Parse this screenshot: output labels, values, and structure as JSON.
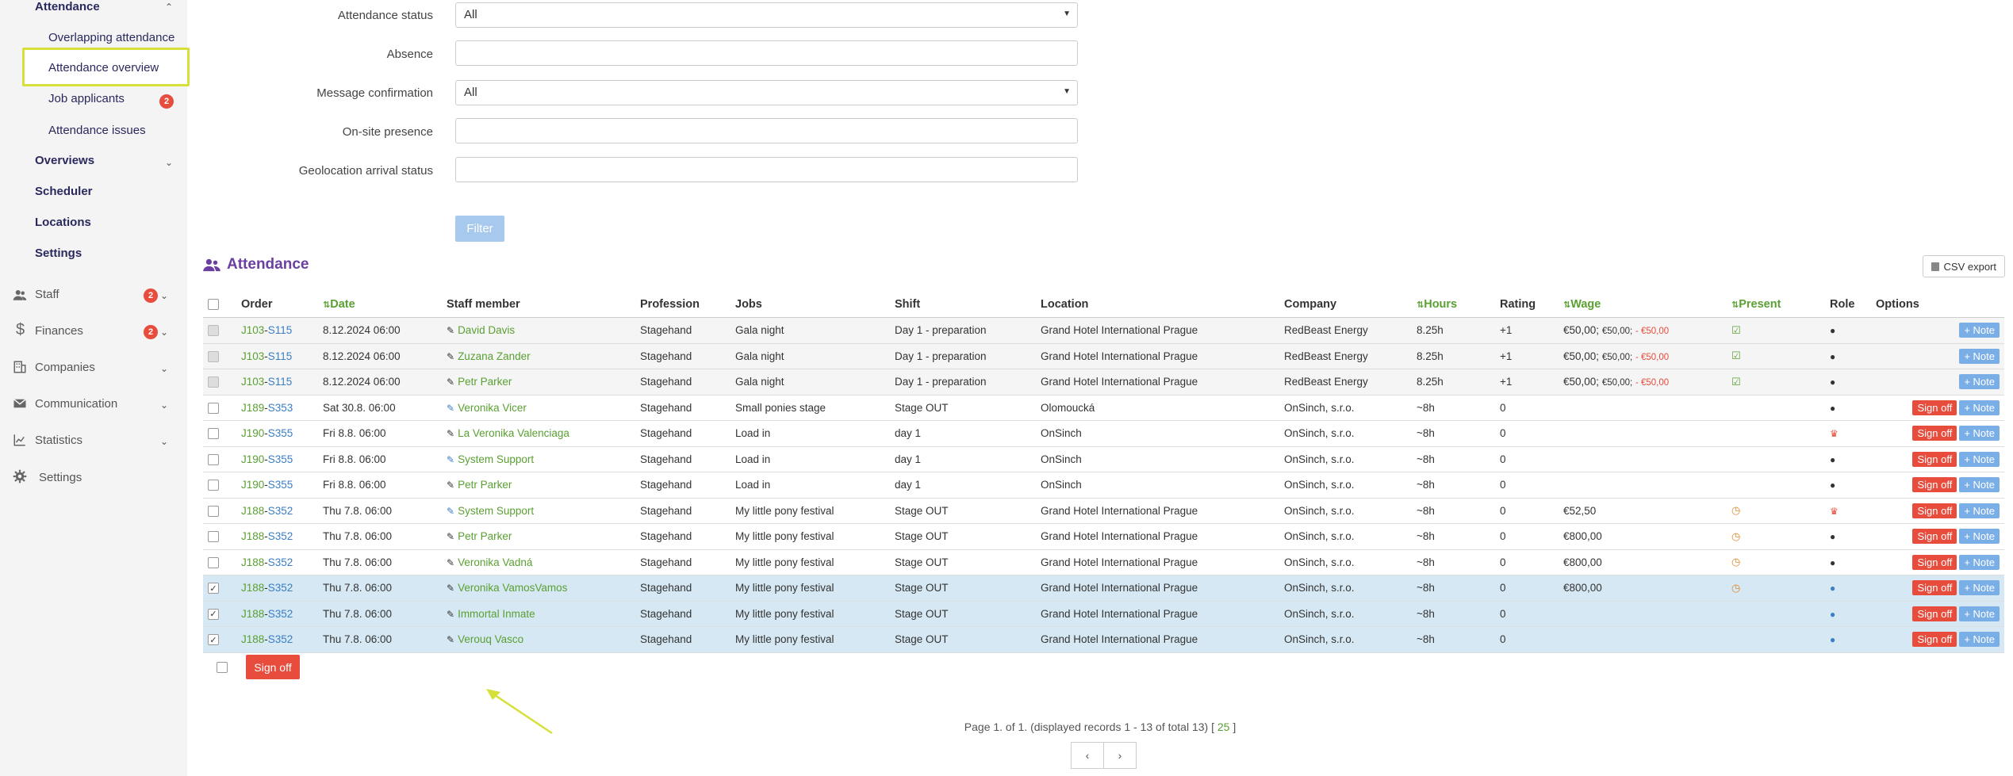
{
  "sidebar": {
    "attendance": "Attendance",
    "overlapping": "Overlapping attendance",
    "overview": "Attendance overview",
    "job_applicants": "Job applicants",
    "job_applicants_badge": "2",
    "issues": "Attendance issues",
    "overviews": "Overviews",
    "scheduler": "Scheduler",
    "locations": "Locations",
    "settings_sub": "Settings",
    "staff": "Staff",
    "staff_badge": "2",
    "finances": "Finances",
    "finances_badge": "2",
    "companies": "Companies",
    "communication": "Communication",
    "statistics": "Statistics",
    "settings": "Settings"
  },
  "filters": {
    "attendance_status_label": "Attendance status",
    "attendance_status_value": "All",
    "absence_label": "Absence",
    "message_confirmation_label": "Message confirmation",
    "message_confirmation_value": "All",
    "onsite_label": "On-site presence",
    "geo_label": "Geolocation arrival status",
    "filter_button": "Filter"
  },
  "section": {
    "title": "Attendance",
    "csv_export": "CSV export"
  },
  "table": {
    "headers": {
      "order": "Order",
      "date": "Date",
      "staff": "Staff member",
      "profession": "Profession",
      "jobs": "Jobs",
      "shift": "Shift",
      "location": "Location",
      "company": "Company",
      "hours": "Hours",
      "rating": "Rating",
      "wage": "Wage",
      "present": "Present",
      "role": "Role",
      "options": "Options"
    },
    "sign_off": "Sign off",
    "note": "Note",
    "rows": [
      {
        "o1": "J103",
        "o2": "S115",
        "date": "8.12.2024 06:00",
        "staff": "David Davis",
        "prof": "Stagehand",
        "jobs": "Gala night",
        "shift": "Day 1 - preparation",
        "loc": "Grand Hotel International Prague",
        "comp": "RedBeast Energy",
        "hours": "8.25h",
        "rating": "+1",
        "w1": "€50,00;",
        "w2": "€50,00;",
        "w3": "- €50,00"
      },
      {
        "o1": "J103",
        "o2": "S115",
        "date": "8.12.2024 06:00",
        "staff": "Zuzana Zander",
        "prof": "Stagehand",
        "jobs": "Gala night",
        "shift": "Day 1 - preparation",
        "loc": "Grand Hotel International Prague",
        "comp": "RedBeast Energy",
        "hours": "8.25h",
        "rating": "+1",
        "w1": "€50,00;",
        "w2": "€50,00;",
        "w3": "- €50,00"
      },
      {
        "o1": "J103",
        "o2": "S115",
        "date": "8.12.2024 06:00",
        "staff": "Petr Parker",
        "prof": "Stagehand",
        "jobs": "Gala night",
        "shift": "Day 1 - preparation",
        "loc": "Grand Hotel International Prague",
        "comp": "RedBeast Energy",
        "hours": "8.25h",
        "rating": "+1",
        "w1": "€50,00;",
        "w2": "€50,00;",
        "w3": "- €50,00"
      },
      {
        "o1": "J189",
        "o2": "S353",
        "date": "Sat 30.8. 06:00",
        "staff": "Veronika Vicer",
        "prof": "Stagehand",
        "jobs": "Small ponies stage",
        "shift": "Stage OUT",
        "loc": "Olomoucká",
        "comp": "OnSinch, s.r.o.",
        "hours": "~8h",
        "rating": "0",
        "w1": "",
        "w2": "",
        "w3": ""
      },
      {
        "o1": "J190",
        "o2": "S355",
        "date": "Fri 8.8. 06:00",
        "staff": "La Veronika Valenciaga",
        "prof": "Stagehand",
        "jobs": "Load in",
        "shift": "day 1",
        "loc": "OnSinch",
        "comp": "OnSinch, s.r.o.",
        "hours": "~8h",
        "rating": "0",
        "w1": "",
        "w2": "",
        "w3": ""
      },
      {
        "o1": "J190",
        "o2": "S355",
        "date": "Fri 8.8. 06:00",
        "staff": "System Support",
        "prof": "Stagehand",
        "jobs": "Load in",
        "shift": "day 1",
        "loc": "OnSinch",
        "comp": "OnSinch, s.r.o.",
        "hours": "~8h",
        "rating": "0",
        "w1": "",
        "w2": "",
        "w3": ""
      },
      {
        "o1": "J190",
        "o2": "S355",
        "date": "Fri 8.8. 06:00",
        "staff": "Petr Parker",
        "prof": "Stagehand",
        "jobs": "Load in",
        "shift": "day 1",
        "loc": "OnSinch",
        "comp": "OnSinch, s.r.o.",
        "hours": "~8h",
        "rating": "0",
        "w1": "",
        "w2": "",
        "w3": ""
      },
      {
        "o1": "J188",
        "o2": "S352",
        "date": "Thu 7.8. 06:00",
        "staff": "System Support",
        "prof": "Stagehand",
        "jobs": "My little pony festival",
        "shift": "Stage OUT",
        "loc": "Grand Hotel International Prague",
        "comp": "OnSinch, s.r.o.",
        "hours": "~8h",
        "rating": "0",
        "w1": "€52,50",
        "w2": "",
        "w3": ""
      },
      {
        "o1": "J188",
        "o2": "S352",
        "date": "Thu 7.8. 06:00",
        "staff": "Petr Parker",
        "prof": "Stagehand",
        "jobs": "My little pony festival",
        "shift": "Stage OUT",
        "loc": "Grand Hotel International Prague",
        "comp": "OnSinch, s.r.o.",
        "hours": "~8h",
        "rating": "0",
        "w1": "€800,00",
        "w2": "",
        "w3": ""
      },
      {
        "o1": "J188",
        "o2": "S352",
        "date": "Thu 7.8. 06:00",
        "staff": "Veronika Vadná",
        "prof": "Stagehand",
        "jobs": "My little pony festival",
        "shift": "Stage OUT",
        "loc": "Grand Hotel International Prague",
        "comp": "OnSinch, s.r.o.",
        "hours": "~8h",
        "rating": "0",
        "w1": "€800,00",
        "w2": "",
        "w3": ""
      },
      {
        "o1": "J188",
        "o2": "S352",
        "date": "Thu 7.8. 06:00",
        "staff": "Veronika VamosVamos",
        "prof": "Stagehand",
        "jobs": "My little pony festival",
        "shift": "Stage OUT",
        "loc": "Grand Hotel International Prague",
        "comp": "OnSinch, s.r.o.",
        "hours": "~8h",
        "rating": "0",
        "w1": "€800,00",
        "w2": "",
        "w3": ""
      },
      {
        "o1": "J188",
        "o2": "S352",
        "date": "Thu 7.8. 06:00",
        "staff": "Immortal Inmate",
        "prof": "Stagehand",
        "jobs": "My little pony festival",
        "shift": "Stage OUT",
        "loc": "Grand Hotel International Prague",
        "comp": "OnSinch, s.r.o.",
        "hours": "~8h",
        "rating": "0",
        "w1": "",
        "w2": "",
        "w3": ""
      },
      {
        "o1": "J188",
        "o2": "S352",
        "date": "Thu 7.8. 06:00",
        "staff": "Verouq Vasco",
        "prof": "Stagehand",
        "jobs": "My little pony festival",
        "shift": "Stage OUT",
        "loc": "Grand Hotel International Prague",
        "comp": "OnSinch, s.r.o.",
        "hours": "~8h",
        "rating": "0",
        "w1": "",
        "w2": "",
        "w3": ""
      }
    ]
  },
  "bulk": {
    "sign_off": "Sign off"
  },
  "pager": {
    "text": "Page 1. of 1. (displayed records 1 - 13 of total 13) [",
    "per_page": "25",
    "close": "]",
    "prev": "‹",
    "next": "›"
  },
  "colors": {
    "accent_green": "#5aa032",
    "title_purple": "#6b3fa0",
    "danger": "#e74c3c",
    "note_blue": "#7aaee6",
    "selected_row": "#d6e8f3",
    "highlight": "#d6e03a"
  }
}
